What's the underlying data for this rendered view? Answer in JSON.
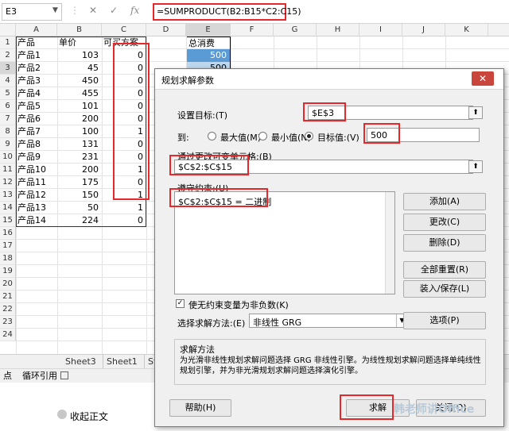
{
  "formula_bar": {
    "name_box": "E3",
    "cancel_glyph": "✕",
    "enter_glyph": "✓",
    "fx_glyph": "fx",
    "formula": "=SUMPRODUCT(B2:B15*C2:C15)"
  },
  "columns": [
    "A",
    "B",
    "C",
    "D",
    "E",
    "F",
    "G",
    "H",
    "I",
    "J",
    "K"
  ],
  "rows": [
    "1",
    "2",
    "3",
    "4",
    "5",
    "6",
    "7",
    "8",
    "9",
    "10",
    "11",
    "12",
    "13",
    "14",
    "15",
    "16",
    "17",
    "18",
    "19",
    "20",
    "21",
    "22",
    "23",
    "24"
  ],
  "sheet": {
    "headers": {
      "a": "产品",
      "b": "单价",
      "c": "可买方案"
    },
    "total_header": "总消费",
    "total_values": [
      "500",
      "500"
    ],
    "data": [
      [
        "产品1",
        "103",
        "0"
      ],
      [
        "产品2",
        "45",
        "0"
      ],
      [
        "产品3",
        "450",
        "0"
      ],
      [
        "产品4",
        "455",
        "0"
      ],
      [
        "产品5",
        "101",
        "0"
      ],
      [
        "产品6",
        "200",
        "0"
      ],
      [
        "产品7",
        "100",
        "1"
      ],
      [
        "产品8",
        "131",
        "0"
      ],
      [
        "产品9",
        "231",
        "0"
      ],
      [
        "产品10",
        "200",
        "1"
      ],
      [
        "产品11",
        "175",
        "0"
      ],
      [
        "产品12",
        "150",
        "1"
      ],
      [
        "产品13",
        "50",
        "1"
      ],
      [
        "产品14",
        "224",
        "0"
      ]
    ]
  },
  "tabs": [
    "Sheet3",
    "Sheet1",
    "St"
  ],
  "status": {
    "mode": "点",
    "circular_ref": "循环引用"
  },
  "collapse_text": "收起正文",
  "dialog": {
    "title": "规划求解参数",
    "close_glyph": "✕",
    "objective_label": "设置目标:(T)",
    "objective_value": "$E$3",
    "to_label": "到:",
    "max_label": "最大值(M)",
    "min_label": "最小值(N)",
    "value_of_label": "目标值:(V)",
    "value_of": "500",
    "changing_label": "通过更改可变单元格:(B)",
    "changing_value": "$C$2:$C$15",
    "constraints_label": "遵守约束:(U)",
    "constraints": [
      "$C$2:$C$15 = 二进制"
    ],
    "buttons": {
      "add": "添加(A)",
      "change": "更改(C)",
      "delete": "删除(D)",
      "reset_all": "全部重置(R)",
      "load_save": "装入/保存(L)",
      "options": "选项(P)",
      "help": "帮助(H)",
      "solve": "求解",
      "close": "关闭(O)"
    },
    "nonneg_label": "使无约束变量为非负数(K)",
    "method_label": "选择求解方法:(E)",
    "method_value": "非线性 GRG",
    "method_section_title": "求解方法",
    "method_desc": "为光滑非线性规划求解问题选择 GRG 非线性引擎。为线性规划求解问题选择单纯线性规划引擎，并为非光滑规划求解问题选择演化引擎。"
  },
  "watermark": "韩老师讲Office"
}
